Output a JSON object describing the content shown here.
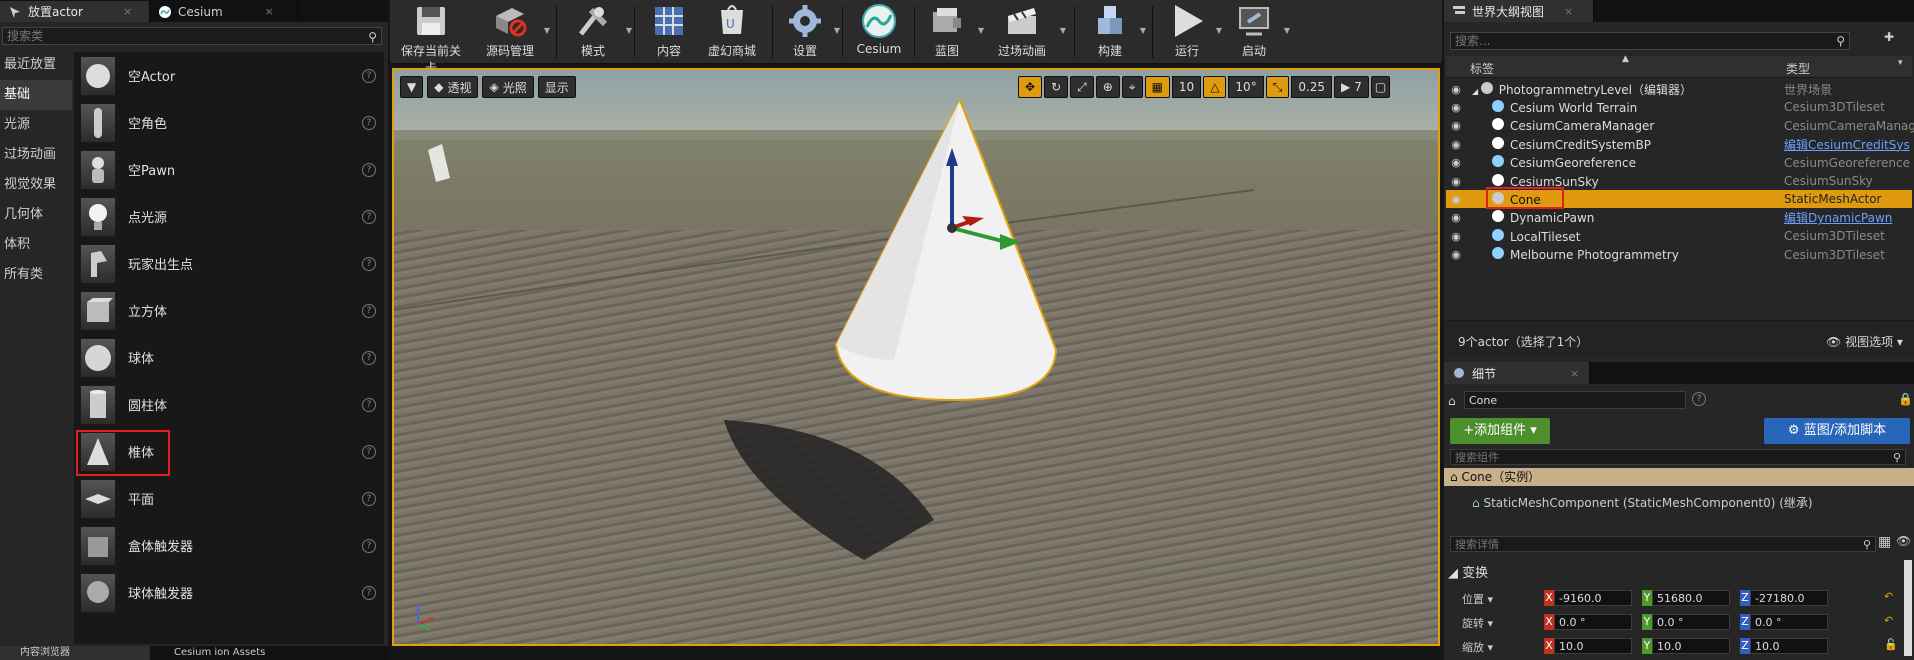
{
  "left_panel": {
    "tabs": [
      {
        "label": "放置actor",
        "close": "×"
      },
      {
        "label": "Cesium",
        "close": "×"
      }
    ],
    "search_placeholder": "搜索类",
    "categories": [
      "最近放置",
      "基础",
      "光源",
      "过场动画",
      "视觉效果",
      "几何体",
      "体积",
      "所有类"
    ],
    "selected_category": "基础",
    "items": [
      "空Actor",
      "空角色",
      "空Pawn",
      "点光源",
      "玩家出生点",
      "立方体",
      "球体",
      "圆柱体",
      "椎体",
      "平面",
      "盒体触发器",
      "球体触发器"
    ],
    "highlighted_item": "椎体",
    "bottom_tabs": [
      "内容浏览器",
      "Cesium ion Assets"
    ]
  },
  "toolbar": {
    "buttons": [
      {
        "label": "保存当前关卡",
        "icon": "save-icon"
      },
      {
        "label": "源码管理",
        "icon": "source-control-icon"
      },
      {
        "label": "模式",
        "icon": "modes-icon"
      },
      {
        "label": "内容",
        "icon": "content-icon"
      },
      {
        "label": "虚幻商城",
        "icon": "marketplace-icon"
      },
      {
        "label": "设置",
        "icon": "settings-icon"
      },
      {
        "label": "Cesium",
        "icon": "cesium-icon"
      },
      {
        "label": "蓝图",
        "icon": "blueprint-icon"
      },
      {
        "label": "过场动画",
        "icon": "cinematics-icon"
      },
      {
        "label": "构建",
        "icon": "build-icon"
      },
      {
        "label": "运行",
        "icon": "play-icon"
      },
      {
        "label": "启动",
        "icon": "launch-icon"
      }
    ]
  },
  "viewport": {
    "left_buttons": [
      "透视",
      "光照",
      "显示"
    ],
    "grid_snap": "10",
    "rotation_snap": "10°",
    "scale_snap": "0.25",
    "camera_speed": "7"
  },
  "outliner": {
    "tab": "世界大纲视图",
    "search_placeholder": "搜索...",
    "col_label": "标签",
    "col_type": "类型",
    "rows": [
      {
        "name": "PhotogrammetryLevel（编辑器）",
        "type": "世界场景",
        "link": false,
        "indent": 0,
        "icon": "#c9c9c9"
      },
      {
        "name": "Cesium World Terrain",
        "type": "Cesium3DTileset",
        "link": false,
        "indent": 1,
        "icon": "#8fd0ff"
      },
      {
        "name": "CesiumCameraManager",
        "type": "CesiumCameraManage",
        "link": false,
        "indent": 1,
        "icon": "#ffffff"
      },
      {
        "name": "CesiumCreditSystemBP",
        "type": "编辑CesiumCreditSys",
        "link": true,
        "indent": 1,
        "icon": "#ffffff"
      },
      {
        "name": "CesiumGeoreference",
        "type": "CesiumGeoreference",
        "link": false,
        "indent": 1,
        "icon": "#8fd0ff"
      },
      {
        "name": "CesiumSunSky",
        "type": "CesiumSunSky",
        "link": false,
        "indent": 1,
        "icon": "#ffffff"
      },
      {
        "name": "Cone",
        "type": "StaticMeshActor",
        "link": false,
        "indent": 1,
        "icon": "#cccccc"
      },
      {
        "name": "DynamicPawn",
        "type": "编辑DynamicPawn",
        "link": true,
        "indent": 1,
        "icon": "#ffffff"
      },
      {
        "name": "LocalTileset",
        "type": "Cesium3DTileset",
        "link": false,
        "indent": 1,
        "icon": "#8fd0ff"
      },
      {
        "name": "Melbourne Photogrammetry",
        "type": "Cesium3DTileset",
        "link": false,
        "indent": 1,
        "icon": "#8fd0ff"
      }
    ],
    "selected_row": "Cone",
    "footer": "9个actor（选择了1个）",
    "view_options": "视图选项"
  },
  "details": {
    "tab": "细节",
    "actor_name": "Cone",
    "add_component": "+添加组件",
    "blueprint_button": "蓝图/添加脚本",
    "component_search": "搜索组件",
    "instance_label": "Cone（实例）",
    "component_row": "StaticMeshComponent (StaticMeshComponent0) (继承)",
    "details_search": "搜索详情",
    "section": "变换",
    "transform": [
      {
        "label": "位置",
        "x": "-9160.0",
        "y": "51680.0",
        "z": "-27180.0"
      },
      {
        "label": "旋转",
        "x": "0.0 °",
        "y": "0.0 °",
        "z": "0.0 °"
      },
      {
        "label": "缩放",
        "x": "10.0",
        "y": "10.0",
        "z": "10.0"
      }
    ]
  },
  "colors": {
    "accent": "#e09a10",
    "highlight_box": "#e02020",
    "link": "#6aa0ff",
    "green_button": "#4c8f2c",
    "blue_button": "#2766b8"
  }
}
